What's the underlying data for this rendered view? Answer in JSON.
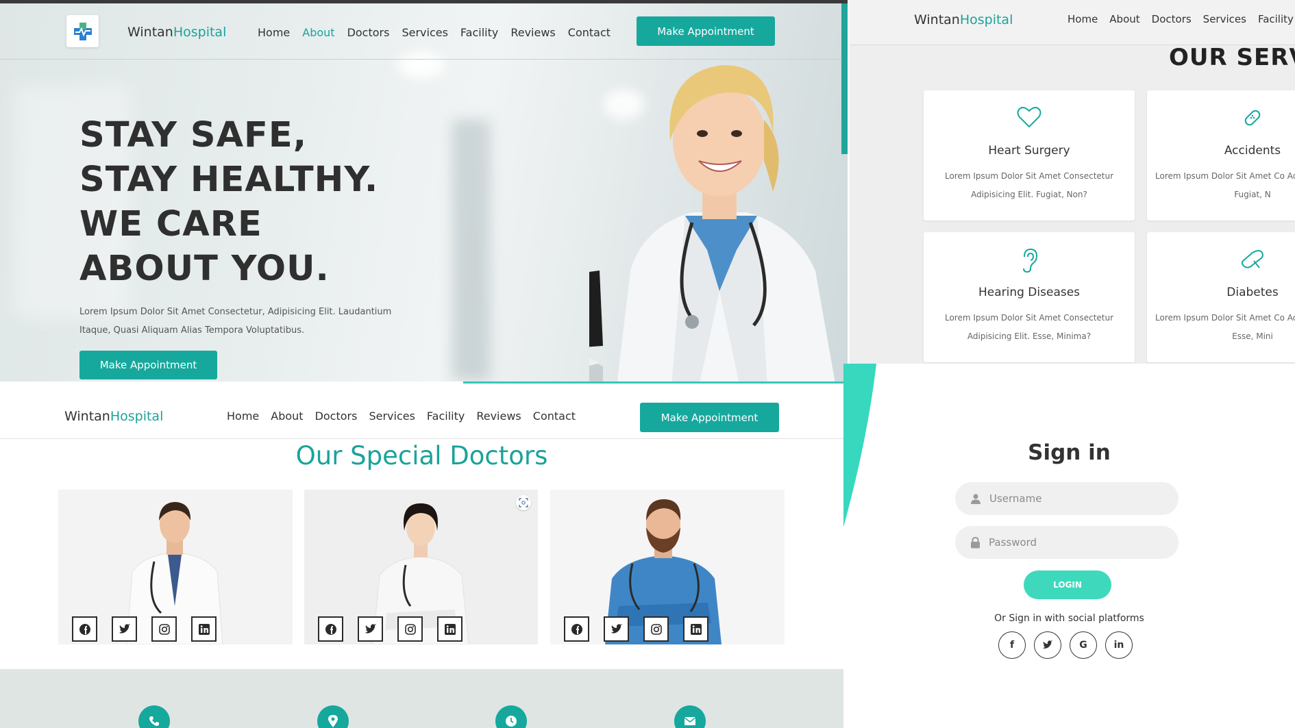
{
  "colors": {
    "accent": "#16a89d",
    "accent_light": "#3ed9bd",
    "text_dark": "#333333"
  },
  "brand": {
    "name_plain": "Wintan",
    "name_accent": "Hospital"
  },
  "nav": {
    "items": [
      "Home",
      "About",
      "Doctors",
      "Services",
      "Facility",
      "Reviews",
      "Contact"
    ],
    "active": "About",
    "cta": "Make Appointment"
  },
  "hero": {
    "title": "STAY SAFE, STAY HEALTHY. WE CARE ABOUT YOU.",
    "subtitle": "Lorem Ipsum Dolor Sit Amet Consectetur, Adipisicing Elit. Laudantium Itaque, Quasi Aliquam Alias Tempora Voluptatibus.",
    "cta": "Make Appointment"
  },
  "services": {
    "nav_items": [
      "Home",
      "About",
      "Doctors",
      "Services",
      "Facility"
    ],
    "title": "OUR SERVIC",
    "cards": [
      {
        "icon": "heart-icon",
        "title": "Heart Surgery",
        "desc": "Lorem Ipsum Dolor Sit Amet Consectetur Adipisicing Elit. Fugiat, Non?"
      },
      {
        "icon": "bandage-icon",
        "title": "Accidents",
        "desc": "Lorem Ipsum Dolor Sit Amet Co Adipisicing Elit. Fugiat, N"
      },
      {
        "icon": "ear-icon",
        "title": "Hearing Diseases",
        "desc": "Lorem Ipsum Dolor Sit Amet Consectetur Adipisicing Elit. Esse, Minima?"
      },
      {
        "icon": "foot-icon",
        "title": "Diabetes",
        "desc": "Lorem Ipsum Dolor Sit Amet Co Adipisicing Elit. Esse, Mini"
      }
    ]
  },
  "doctors": {
    "title": "Our Special Doctors",
    "cards": [
      {
        "socials": [
          "facebook-icon",
          "twitter-icon",
          "instagram-icon",
          "linkedin-icon"
        ]
      },
      {
        "socials": [
          "facebook-icon",
          "twitter-icon",
          "instagram-icon",
          "linkedin-icon"
        ]
      },
      {
        "socials": [
          "facebook-icon",
          "twitter-icon",
          "instagram-icon",
          "linkedin-icon"
        ]
      }
    ],
    "contact_icons": [
      "phone-icon",
      "location-icon",
      "clock-icon",
      "mail-icon"
    ]
  },
  "signin": {
    "title": "Sign in",
    "username_placeholder": "Username",
    "password_placeholder": "Password",
    "login_label": "LOGIN",
    "social_text": "Or Sign in with social platforms",
    "social_letters": [
      "f",
      "G",
      "in"
    ]
  }
}
